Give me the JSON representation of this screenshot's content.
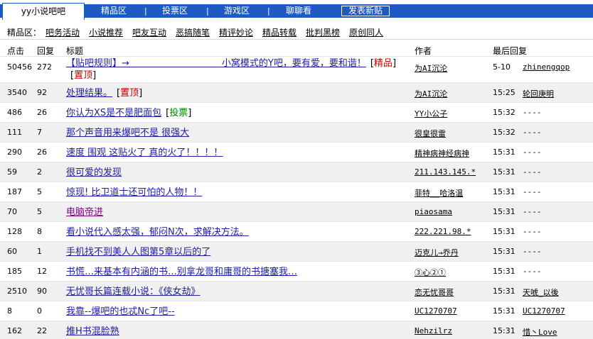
{
  "tabs": {
    "active": "yy小说吧吧",
    "items": [
      "精品区",
      "投票区",
      "游戏区",
      "聊聊看"
    ],
    "separator": "|",
    "post_button": "发表新贴"
  },
  "subnav": {
    "label": "精品区：",
    "items": [
      "吧务活动",
      "小说推荐",
      "吧友互动",
      "恶搞随笔",
      "精评妙论",
      "精品转载",
      "批判黑榜",
      "原创同人"
    ]
  },
  "table": {
    "headers": {
      "clicks": "点击",
      "replies": "回复",
      "title": "标题",
      "author": "作者",
      "last_reply": "最后回复"
    },
    "rows": [
      {
        "clicks": "50456",
        "replies": "272",
        "title": "【贴吧规则】→　　　　　　　　　　小窝模式的Y吧，要有爱，要和谐！",
        "tags": [
          {
            "text": "精品",
            "color": "red"
          },
          {
            "text": "置顶",
            "color": "red"
          }
        ],
        "author": "为AI沉沦",
        "time": "5-10",
        "reply_user": "zhinengqop"
      },
      {
        "clicks": "3540",
        "replies": "92",
        "title": "处理结果。",
        "tags": [
          {
            "text": "置顶",
            "color": "red"
          }
        ],
        "author": "为AI沉沦",
        "time": "15:25",
        "reply_user": "轮回庚明"
      },
      {
        "clicks": "486",
        "replies": "26",
        "title": "你认为XS是不是肥面包",
        "tags": [
          {
            "text": "投票",
            "color": "green"
          }
        ],
        "author": "YY小公子",
        "time": "15:32",
        "reply_user": "----"
      },
      {
        "clicks": "111",
        "replies": "7",
        "title": "那个声音用来爆吧不是 很强大",
        "tags": [],
        "author": "很皇很雷",
        "time": "15:32",
        "reply_user": "----"
      },
      {
        "clicks": "290",
        "replies": "26",
        "title": "速度 围观 这贴火了 真的火了！！！！",
        "tags": [],
        "author": "精神病神经病神",
        "time": "15:31",
        "reply_user": "----"
      },
      {
        "clicks": "59",
        "replies": "2",
        "title": "很可爱的发现",
        "tags": [],
        "author": "211.143.145.*",
        "time": "15:31",
        "reply_user": "----"
      },
      {
        "clicks": "187",
        "replies": "5",
        "title": "惊现! 比卫道士还可怕的人物！！",
        "tags": [],
        "author": "菲特__哈洛温",
        "time": "15:31",
        "reply_user": "----"
      },
      {
        "clicks": "70",
        "replies": "5",
        "title": "电脑帝进",
        "tags": [],
        "author": "piaosama",
        "time": "15:31",
        "reply_user": "----",
        "title_color": "purple"
      },
      {
        "clicks": "128",
        "replies": "8",
        "title": "看小说代入感太强，郁闷N次，求解决方法。",
        "tags": [],
        "author": "222.221.98.*",
        "time": "15:31",
        "reply_user": "----"
      },
      {
        "clicks": "60",
        "replies": "1",
        "title": "手机找不到美人人图第5章以后的了",
        "tags": [],
        "author": "迈克儿→乔丹",
        "time": "15:31",
        "reply_user": "----"
      },
      {
        "clicks": "185",
        "replies": "12",
        "title": "书慌…来基本有内涵的书…别拿龙哥和庸哥的书搪塞我…",
        "tags": [],
        "author": "③心②①",
        "time": "15:31",
        "reply_user": "----"
      },
      {
        "clicks": "2510",
        "replies": "90",
        "title": "无忧哥长篇连载小说：《侠女劫》",
        "tags": [],
        "author": "恋无忧哥哥",
        "time": "15:31",
        "reply_user": "天唬_以後"
      },
      {
        "clicks": "8",
        "replies": "0",
        "title": "我靠--爆吧的也忒Nc了吧--",
        "tags": [],
        "author": "UC1270707",
        "time": "15:31",
        "reply_user": "UC1270707"
      },
      {
        "clicks": "162",
        "replies": "22",
        "title": "推H书混脸熟",
        "tags": [],
        "author": "Nehzilrz",
        "time": "15:31",
        "reply_user": "惜丶Love"
      }
    ]
  }
}
